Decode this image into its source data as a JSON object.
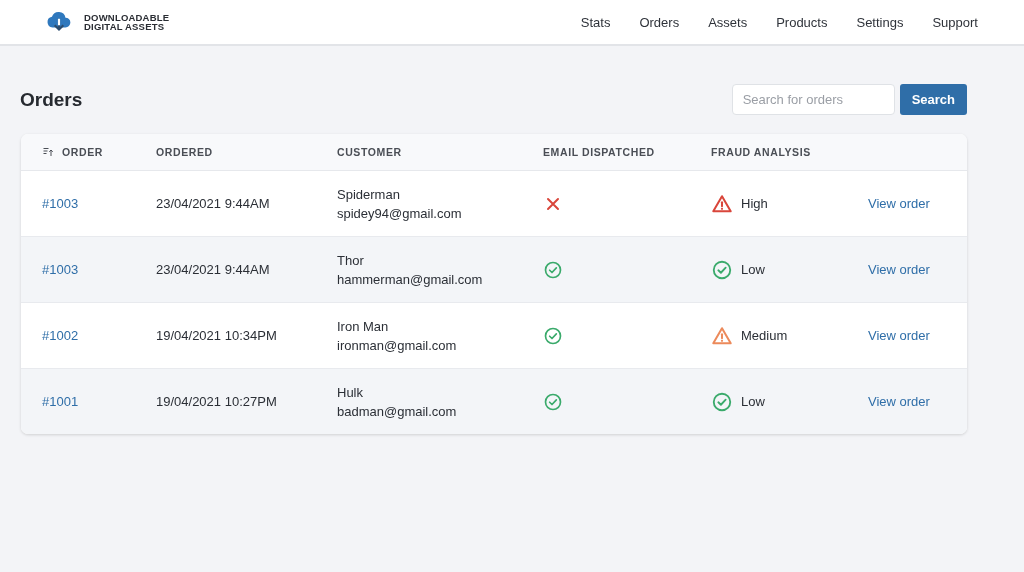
{
  "brand": {
    "line_1": "DOWNLOADABLE",
    "line_2": "DIGITAL ASSETS"
  },
  "nav": [
    {
      "label": "Stats"
    },
    {
      "label": "Orders"
    },
    {
      "label": "Assets"
    },
    {
      "label": "Products"
    },
    {
      "label": "Settings"
    },
    {
      "label": "Support"
    }
  ],
  "page_title": "Orders",
  "search": {
    "placeholder": "Search for orders",
    "button": "Search"
  },
  "table": {
    "columns": [
      "ORDER",
      "ORDERED",
      "CUSTOMER",
      "EMAIL DISPATCHED",
      "FRAUD ANALYSIS"
    ],
    "rows": [
      {
        "order": "#1003",
        "ordered": "23/04/2021 9:44AM",
        "name": "Spiderman",
        "email": "spidey94@gmail.com",
        "dispatched": false,
        "kind": "high",
        "fraud": "High",
        "action": "View order"
      },
      {
        "order": "#1003",
        "ordered": "23/04/2021 9:44AM",
        "name": "Thor",
        "email": "hammerman@gmail.com",
        "dispatched": true,
        "kind": "low",
        "fraud": "Low",
        "action": "View order"
      },
      {
        "order": "#1002",
        "ordered": "19/04/2021 10:34PM",
        "name": "Iron Man",
        "email": "ironman@gmail.com",
        "dispatched": true,
        "kind": "medium",
        "fraud": "Medium",
        "action": "View order"
      },
      {
        "order": "#1001",
        "ordered": "19/04/2021 10:27PM",
        "name": "Hulk",
        "email": "badman@gmail.com",
        "dispatched": true,
        "kind": "low",
        "fraud": "Low",
        "action": "View order"
      }
    ]
  }
}
